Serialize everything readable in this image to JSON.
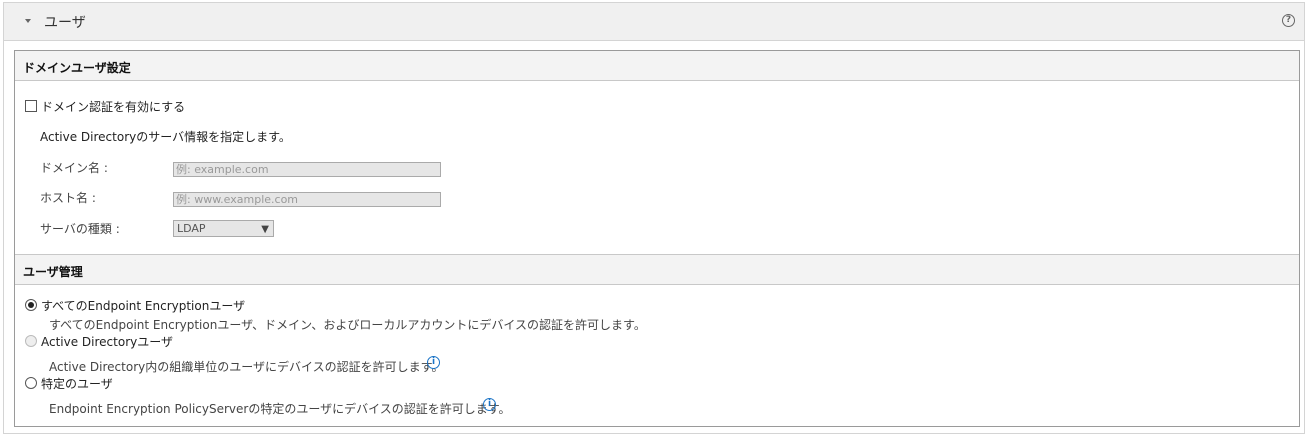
{
  "panel": {
    "title": "ユーザ",
    "help_icon": "?"
  },
  "domain_section": {
    "title": "ドメインユーザ設定",
    "enable_label": "ドメイン認証を有効にする",
    "enabled": false,
    "description": "Active Directoryのサーバ情報を指定します。",
    "domain_name_label": "ドメイン名 :",
    "domain_name_placeholder": "例: example.com",
    "host_name_label": "ホスト名 :",
    "host_name_placeholder": "例: www.example.com",
    "server_type_label": "サーバの種類 :",
    "server_type_value": "LDAP"
  },
  "user_section": {
    "title": "ユーザ管理",
    "options": [
      {
        "label": "すべてのEndpoint Encryptionユーザ",
        "description": "すべてのEndpoint Encryptionユーザ、ドメイン、およびローカルアカウントにデバイスの認証を許可します。",
        "selected": true,
        "disabled": false
      },
      {
        "label": "Active Directoryユーザ",
        "description": "Active Directory内の組織単位のユーザにデバイスの認証を許可します。",
        "selected": false,
        "disabled": true
      },
      {
        "label": "特定のユーザ",
        "description": "Endpoint Encryption PolicyServerの特定のユーザにデバイスの認証を許可します。",
        "selected": false,
        "disabled": false
      }
    ],
    "info_icon": "i"
  }
}
